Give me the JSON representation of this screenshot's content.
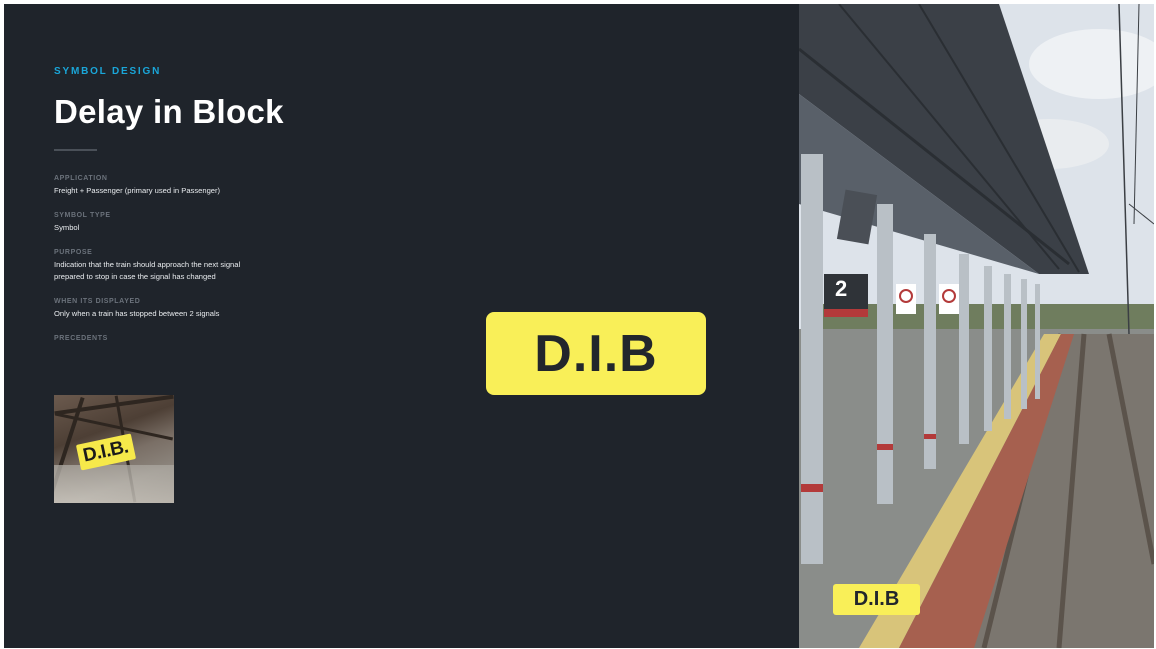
{
  "header": {
    "eyebrow": "SYMBOL DESIGN",
    "title": "Delay in Block"
  },
  "fields": [
    {
      "label": "APPLICATION",
      "value": "Freight + Passenger (primary used in Passenger)"
    },
    {
      "label": "SYMBOL TYPE",
      "value": "Symbol"
    },
    {
      "label": "PURPOSE",
      "value": "Indication that the train should approach the next signal\nprepared to stop in case the signal has changed"
    },
    {
      "label": "WHEN ITS DISPLAYED",
      "value": "Only when a train has stopped between 2 signals"
    },
    {
      "label": "PRECEDENTS",
      "value": ""
    }
  ],
  "precedent_image": {
    "sign_text": "D.I.B."
  },
  "main_sign": {
    "text": "D.I.B"
  },
  "photo": {
    "platform_number": "2",
    "overlay_sign": "D.I.B"
  },
  "colors": {
    "background": "#1f242b",
    "accent": "#1aa6d9",
    "sign_yellow": "#f9ef58"
  }
}
